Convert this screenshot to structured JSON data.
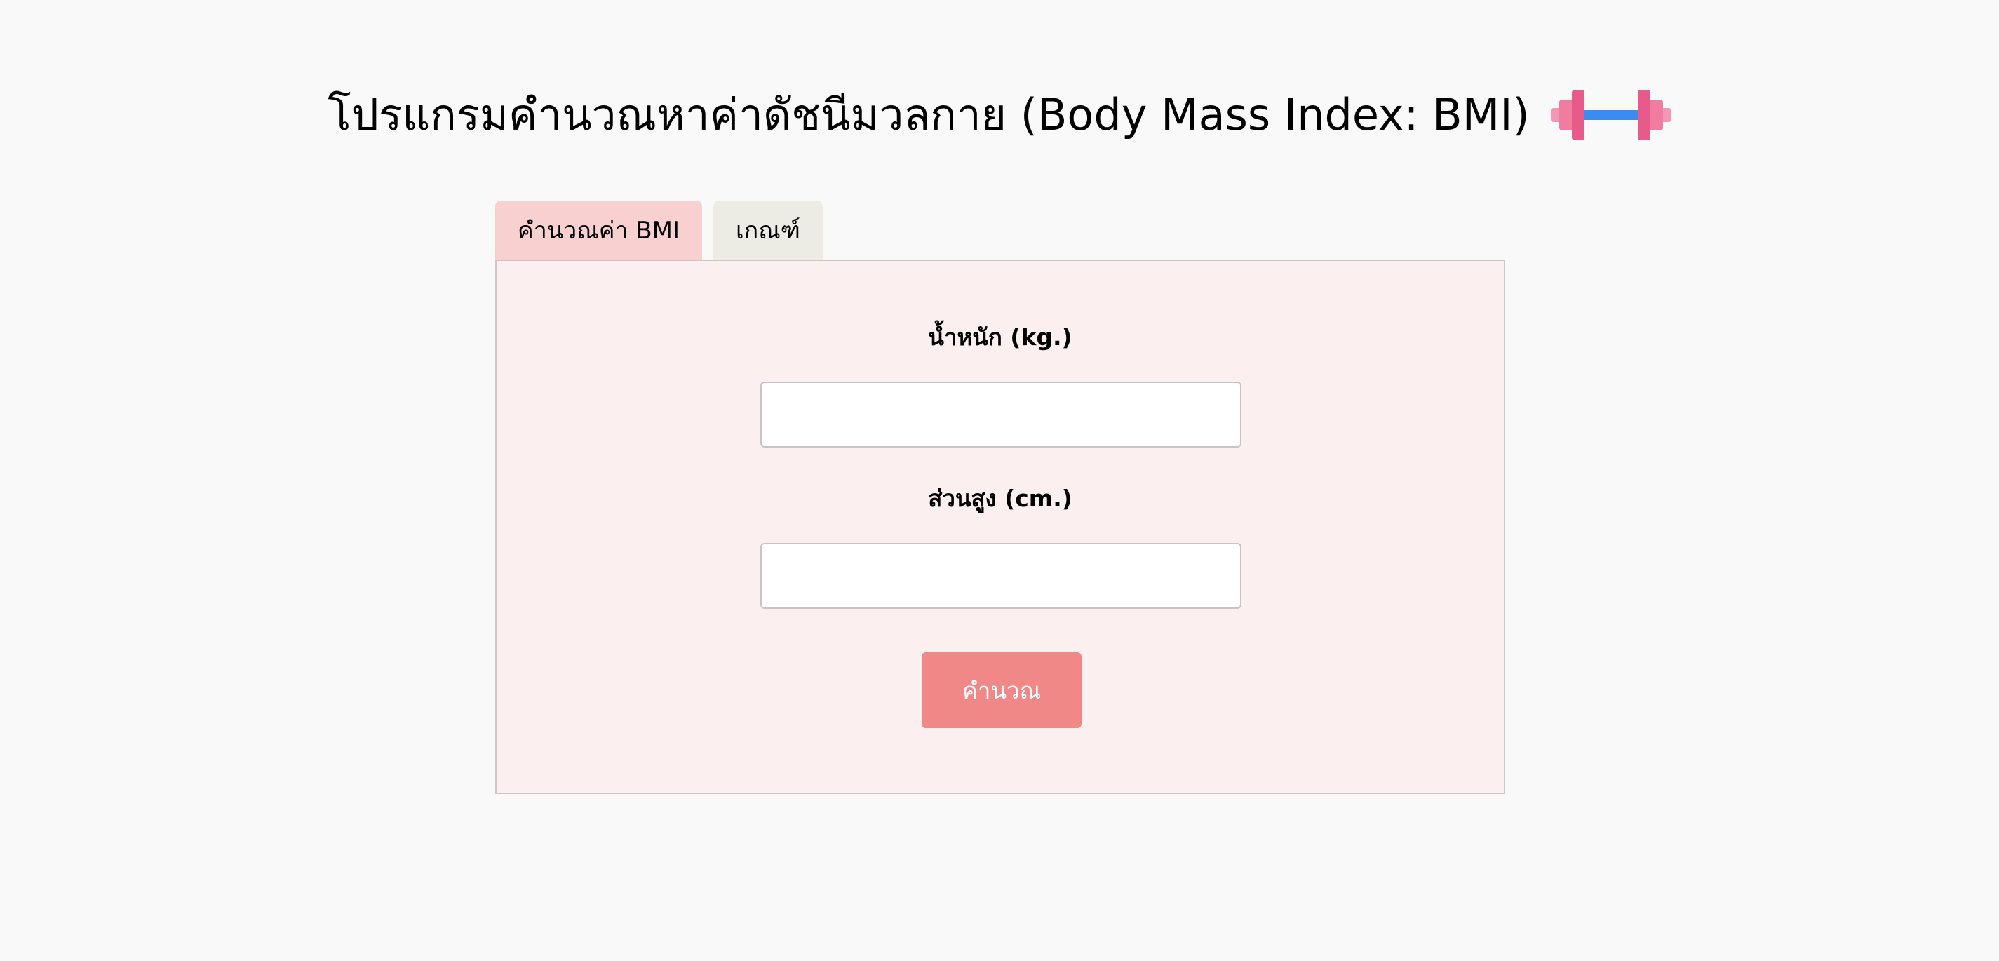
{
  "header": {
    "title": "โปรแกรมคำนวณหาค่าดัชนีมวลกาย (Body Mass Index: BMI)",
    "title_icon": "dumbbell-icon"
  },
  "tabs": [
    {
      "label": "คำนวณค่า BMI",
      "active": true
    },
    {
      "label": "เกณฑ์",
      "active": false
    }
  ],
  "form": {
    "weight_label": "น้ำหนัก (kg.)",
    "weight_value": "",
    "height_label": "ส่วนสูง (cm.)",
    "height_value": "",
    "submit_label": "คำนวณ"
  },
  "colors": {
    "page_background": "#f9f9fa",
    "tab_active": "#f9d0d0",
    "tab_inactive": "#ecece4",
    "panel_background": "#fcefef",
    "button_background": "#f08888",
    "dumbbell_plate": "#e85a8a",
    "dumbbell_bar": "#3b8cf0"
  }
}
